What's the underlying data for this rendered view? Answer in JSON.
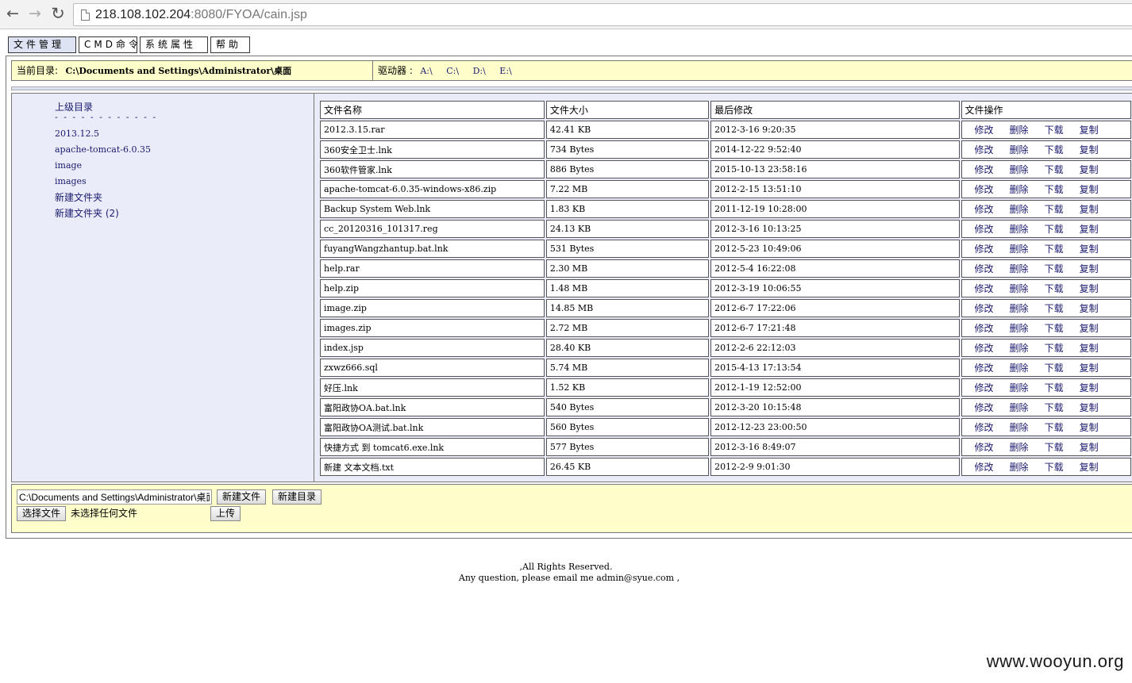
{
  "browser": {
    "url_host": "218.108.102.204",
    "url_rest": ":8080/FYOA/cain.jsp",
    "back_icon": "←",
    "forward_icon": "→",
    "reload_icon": "↻"
  },
  "menu": [
    {
      "label": "文件管理"
    },
    {
      "label": "CMD命令"
    },
    {
      "label": "系统属性"
    },
    {
      "label": "帮助"
    }
  ],
  "path_bar": {
    "current_label": "当前目录:",
    "current_path": "C:\\Documents and Settings\\Administrator\\桌面",
    "drives_label": "驱动器 :",
    "drives": [
      "A:\\",
      "C:\\",
      "D:\\",
      "E:\\"
    ]
  },
  "dirs": {
    "parent": "上级目录",
    "separator": "- - - - - - - - - - - -",
    "items": [
      "2013.12.5",
      "apache-tomcat-6.0.35",
      "image",
      "images",
      "新建文件夹",
      "新建文件夹 (2)"
    ]
  },
  "table": {
    "headers": [
      "文件名称",
      "文件大小",
      "最后修改",
      "文件操作"
    ],
    "ops": [
      "修改",
      "删除",
      "下载",
      "复制"
    ],
    "rows": [
      [
        "2012.3.15.rar",
        "42.41 KB",
        "2012-3-16 9:20:35"
      ],
      [
        "360安全卫士.lnk",
        "734 Bytes",
        "2014-12-22 9:52:40"
      ],
      [
        "360软件管家.lnk",
        "886 Bytes",
        "2015-10-13 23:58:16"
      ],
      [
        "apache-tomcat-6.0.35-windows-x86.zip",
        "7.22 MB",
        "2012-2-15 13:51:10"
      ],
      [
        "Backup System Web.lnk",
        "1.83 KB",
        "2011-12-19 10:28:00"
      ],
      [
        "cc_20120316_101317.reg",
        "24.13 KB",
        "2012-3-16 10:13:25"
      ],
      [
        "fuyangWangzhantup.bat.lnk",
        "531 Bytes",
        "2012-5-23 10:49:06"
      ],
      [
        "help.rar",
        "2.30 MB",
        "2012-5-4 16:22:08"
      ],
      [
        "help.zip",
        "1.48 MB",
        "2012-3-19 10:06:55"
      ],
      [
        "image.zip",
        "14.85 MB",
        "2012-6-7 17:22:06"
      ],
      [
        "images.zip",
        "2.72 MB",
        "2012-6-7 17:21:48"
      ],
      [
        "index.jsp",
        "28.40 KB",
        "2012-2-6 22:12:03"
      ],
      [
        "zxwz666.sql",
        "5.74 MB",
        "2015-4-13 17:13:54"
      ],
      [
        "好压.lnk",
        "1.52 KB",
        "2012-1-19 12:52:00"
      ],
      [
        "富阳政协OA.bat.lnk",
        "540 Bytes",
        "2012-3-20 10:15:48"
      ],
      [
        "富阳政协OA测试.bat.lnk",
        "560 Bytes",
        "2012-12-23 23:00:50"
      ],
      [
        "快捷方式 到 tomcat6.exe.lnk",
        "577 Bytes",
        "2012-3-16 8:49:07"
      ],
      [
        "新建 文本文档.txt",
        "26.45 KB",
        "2012-2-9 9:01:30"
      ]
    ]
  },
  "bottom": {
    "path_value": "C:\\Documents and Settings\\Administrator\\桌面",
    "new_file": "新建文件",
    "new_dir": "新建目录",
    "choose_file": "选择文件",
    "no_file": "未选择任何文件",
    "upload": "上传"
  },
  "footer": {
    "line1": ",All Rights Reserved.",
    "line2": "Any question, please email me admin@syue.com ,"
  },
  "watermark": "www.wooyun.org"
}
